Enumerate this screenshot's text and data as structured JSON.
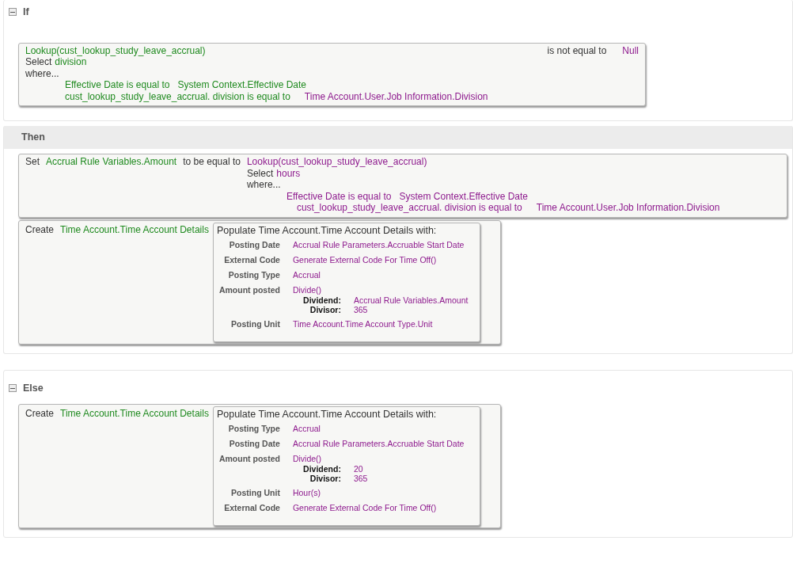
{
  "if_section": {
    "heading": "If",
    "expanded": true,
    "condition": {
      "lookup": {
        "text": "Lookup(cust_lookup_study_leave_accrual)",
        "color": "#1f8a1f"
      },
      "select_label": "Select",
      "select_field": {
        "text": "division",
        "color": "#1f8a1f"
      },
      "where": "where...",
      "clauses": [
        {
          "condition": {
            "text": "Effective Date is equal to",
            "color": "#1f8a1f"
          },
          "value": {
            "text": "System Context.Effective Date",
            "color": "#1f8a1f"
          }
        },
        {
          "condition": {
            "text": "cust_lookup_study_leave_accrual. division is equal to",
            "color": "#1f8a1f"
          },
          "value": {
            "text": "Time Account.User.Job Information.Division",
            "color": "#8e1b8e"
          }
        }
      ],
      "operator": "is not equal to",
      "value": {
        "text": "Null",
        "color": "#8e1b8e"
      }
    }
  },
  "then_section": {
    "heading": "Then",
    "actions": [
      {
        "kind": "set",
        "verb": "Set",
        "target": {
          "text": "Accrual Rule Variables.Amount",
          "color": "#1f8a1f"
        },
        "connector": "to be equal to",
        "lookup": {
          "text": "Lookup(cust_lookup_study_leave_accrual)",
          "color": "#8e1b8e"
        },
        "select_label": "Select",
        "select_field": {
          "text": "hours",
          "color": "#8e1b8e"
        },
        "where": "where...",
        "clauses": [
          {
            "condition": {
              "text": "Effective Date is equal to",
              "color": "#8e1b8e"
            },
            "value": {
              "text": "System Context.Effective Date",
              "color": "#8e1b8e"
            }
          },
          {
            "condition": {
              "text": "cust_lookup_study_leave_accrual. division is equal to",
              "color": "#8e1b8e"
            },
            "value": {
              "text": "Time Account.User.Job Information.Division",
              "color": "#8e1b8e"
            }
          }
        ]
      },
      {
        "kind": "create",
        "verb": "Create",
        "target": {
          "text": "Time Account.Time Account Details",
          "color": "#1f8a1f"
        },
        "populate": {
          "title": "Populate Time Account.Time Account Details with:",
          "fields": [
            {
              "kind": "value",
              "label": "Posting Date",
              "value": "Accrual Rule Parameters.Accruable Start Date"
            },
            {
              "kind": "value",
              "label": "External Code",
              "value": "Generate External Code For Time Off()"
            },
            {
              "kind": "value",
              "label": "Posting Type",
              "value": "Accrual"
            },
            {
              "kind": "divide",
              "label": "Amount posted",
              "value": "Divide()",
              "args": [
                {
                  "label": "Dividend:",
                  "value": "Accrual Rule Variables.Amount"
                },
                {
                  "label": "Divisor:",
                  "value": "365"
                }
              ]
            },
            {
              "kind": "value",
              "label": "Posting Unit",
              "value": "Time Account.Time Account Type.Unit"
            }
          ]
        }
      }
    ]
  },
  "else_section": {
    "heading": "Else",
    "expanded": true,
    "actions": [
      {
        "kind": "create",
        "verb": "Create",
        "target": {
          "text": "Time Account.Time Account Details",
          "color": "#1f8a1f"
        },
        "populate": {
          "title": "Populate Time Account.Time Account Details with:",
          "fields": [
            {
              "kind": "value",
              "label": "Posting Type",
              "value": "Accrual"
            },
            {
              "kind": "value",
              "label": "Posting Date",
              "value": "Accrual Rule Parameters.Accruable Start Date"
            },
            {
              "kind": "divide",
              "label": "Amount posted",
              "value": "Divide()",
              "args": [
                {
                  "label": "Dividend:",
                  "value": "20"
                },
                {
                  "label": "Divisor:",
                  "value": "365"
                }
              ]
            },
            {
              "kind": "value",
              "label": "Posting Unit",
              "value": "Hour(s)"
            },
            {
              "kind": "value",
              "label": "External Code",
              "value": "Generate External Code For Time Off()"
            }
          ]
        }
      }
    ]
  }
}
